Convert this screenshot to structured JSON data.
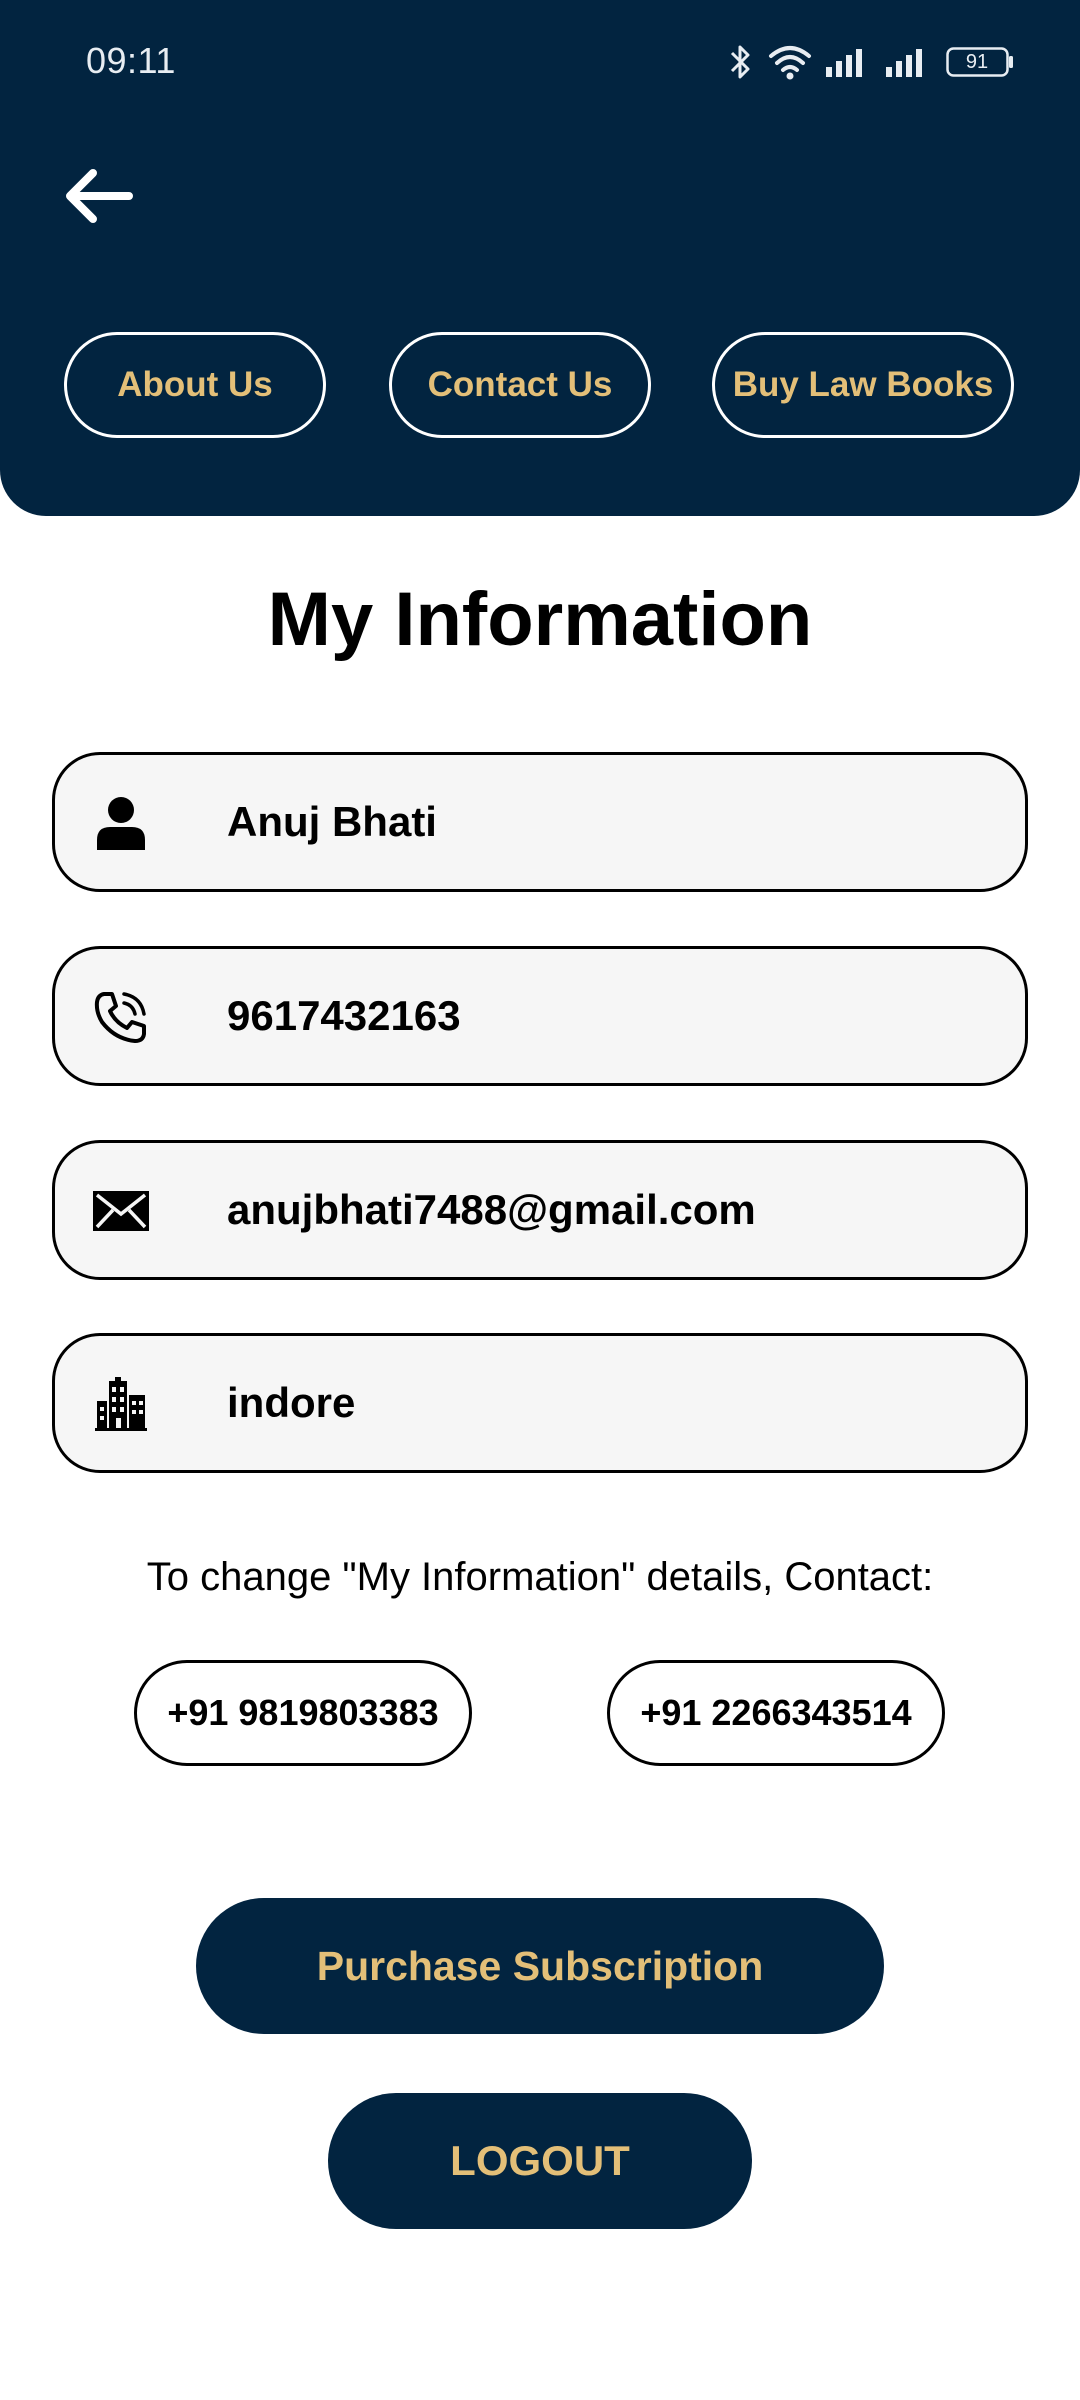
{
  "status_bar": {
    "time": "09:11",
    "battery": "91"
  },
  "header": {
    "back_icon": "arrow-left-icon",
    "nav": {
      "about": "About Us",
      "contact": "Contact Us",
      "books": "Buy Law Books"
    }
  },
  "page": {
    "title": "My Information"
  },
  "fields": {
    "name": {
      "icon": "person-icon",
      "value": "Anuj Bhati"
    },
    "phone": {
      "icon": "phone-icon",
      "value": "9617432163"
    },
    "email": {
      "icon": "mail-icon",
      "value": "anujbhati7488@gmail.com"
    },
    "city": {
      "icon": "city-icon",
      "value": "indore"
    }
  },
  "contact": {
    "note": "To change \"My Information\" details, Contact:",
    "phone_1": "+91 9819803383",
    "phone_2": "+91 2266343514"
  },
  "actions": {
    "purchase": "Purchase Subscription",
    "logout": "LOGOUT"
  },
  "colors": {
    "header_bg": "#022440",
    "accent_gold": "#e3bf78",
    "field_bg": "#f6f6f6"
  }
}
